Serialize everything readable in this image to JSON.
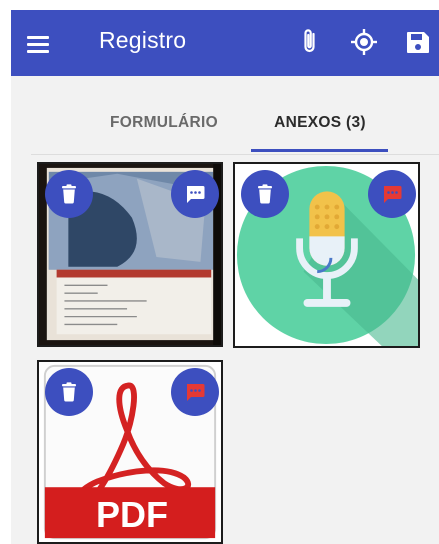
{
  "appbar": {
    "title": "Registro",
    "color": "#3d4fbf",
    "actions": [
      "menu-icon",
      "attach-icon",
      "gps-icon",
      "save-icon"
    ]
  },
  "tabs": [
    {
      "label": "FORMULÁRIO",
      "active": false
    },
    {
      "label": "ANEXOS (3)",
      "active": true
    }
  ],
  "attachments": [
    {
      "type": "photo",
      "comment_status": "has-comment",
      "comment_color": "#ffffff"
    },
    {
      "type": "audio",
      "comment_status": "no-comment",
      "comment_color": "#e53935"
    },
    {
      "type": "pdf",
      "comment_status": "no-comment",
      "comment_color": "#e53935",
      "badge": "PDF"
    }
  ]
}
